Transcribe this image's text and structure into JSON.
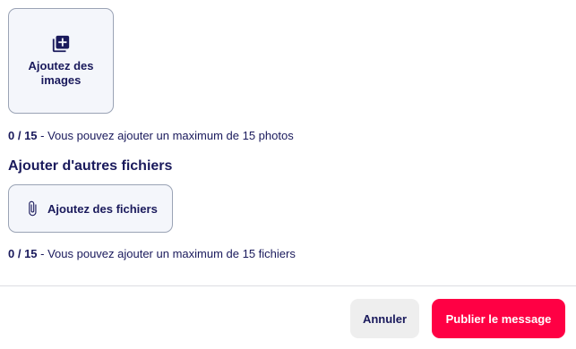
{
  "images": {
    "button_label": "Ajoutez des images",
    "count": "0 / 15",
    "hint": " - Vous pouvez ajouter un maximum de 15 photos"
  },
  "files": {
    "section_title": "Ajouter d'autres fichiers",
    "button_label": "Ajoutez des fichiers",
    "count": "0 / 15",
    "hint": " - Vous pouvez ajouter un maximum de 15 fichiers"
  },
  "footer": {
    "cancel_label": "Annuler",
    "publish_label": "Publier le message"
  },
  "colors": {
    "text": "#1a1a5c",
    "accent": "#ff0044",
    "tile_bg": "#f4f6fb",
    "tile_border": "#9aa3b5",
    "cancel_bg": "#eeeeee"
  },
  "icons": {
    "images": "add-photo-library-icon",
    "files": "paperclip-icon"
  }
}
